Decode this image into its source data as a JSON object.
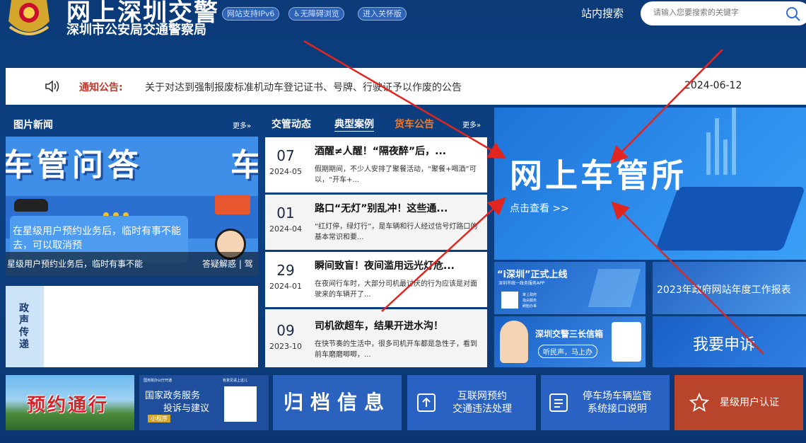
{
  "header": {
    "title": "网上深圳交警",
    "subtitle": "深圳市公安局交通警察局",
    "badges": [
      "网站支持IPv6",
      "♿无障碍浏览",
      "进入关怀版"
    ],
    "search_label": "站内搜索",
    "search_placeholder": "请输入您要搜索的关键字"
  },
  "notice": {
    "label": "通知公告:",
    "text": "关于对达到强制报废标准机动车登记证书、号牌、行驶证予以作废的公告",
    "date": "2024-06-12"
  },
  "photo_news": {
    "heading": "图片新闻",
    "more": "更多»",
    "banner_text": "车管问答",
    "banner_text2": "车",
    "card_text": "在星级用户预约业务后，临时有事不能去，可以取消预",
    "caption": "星级用户预约业务后，临时有事不能",
    "caption2": "答疑解惑 | 驾"
  },
  "political": {
    "label": "政声传递"
  },
  "news_column": {
    "tabs": [
      "交管动态",
      "典型案例",
      "货车公告"
    ],
    "more": "更多»",
    "items": [
      {
        "day": "07",
        "ym": "2024-05",
        "title": "酒醒≠人醒！“隔夜醉”后，...",
        "desc": "假期期间，不少人安排了聚餐活动，“聚餐+喝酒”可以，“开车+..."
      },
      {
        "day": "01",
        "ym": "2024-04",
        "title": "路口“无灯”别乱冲！这些通...",
        "desc": "“红灯停，绿灯行”，是车辆和行人经过信号灯路口的基本常识和要..."
      },
      {
        "day": "29",
        "ym": "2024-01",
        "title": "瞬间致盲！夜间滥用远光灯危...",
        "desc": "在夜间行车时，大部分司机最讨厌的行为应该是对面驶来的车辆开了..."
      },
      {
        "day": "09",
        "ym": "2023-10",
        "title": "司机欲超车，结果开进水沟！",
        "desc": "在快节奏的生活中，很多司机开车都是急性子，看到前车磨磨唧唧，..."
      }
    ]
  },
  "right_banner": {
    "title": "网上车管所",
    "link": "点击查看 >>"
  },
  "tiles": {
    "ishenzhen": "“i深圳”正式上线",
    "ishenzhen_sub": "深圳市统一政务服务APP",
    "ishenzhen_items": [
      "掌上政府",
      "指尖服务",
      "刷脸办事"
    ],
    "report": "2023年政府网站年度工作报表",
    "mailbox": "深圳交警三长信箱",
    "mailbox_sub": "听民声，马上办",
    "appeal": "我要申诉"
  },
  "bottom": {
    "appointment": "预约通行",
    "gov_top": "国务院办公厅开通",
    "gov_top_right": "有意见请上这儿",
    "gov_title": "国家政务服务",
    "gov_title2": "投诉与建议",
    "gov_tag": "小程序",
    "archive": "归档信息",
    "online_1": "互联网预约",
    "online_2": "交通违法处理",
    "parking_1": "停车场车辆监管",
    "parking_2": "系统接口说明",
    "star": "星级用户认证"
  }
}
